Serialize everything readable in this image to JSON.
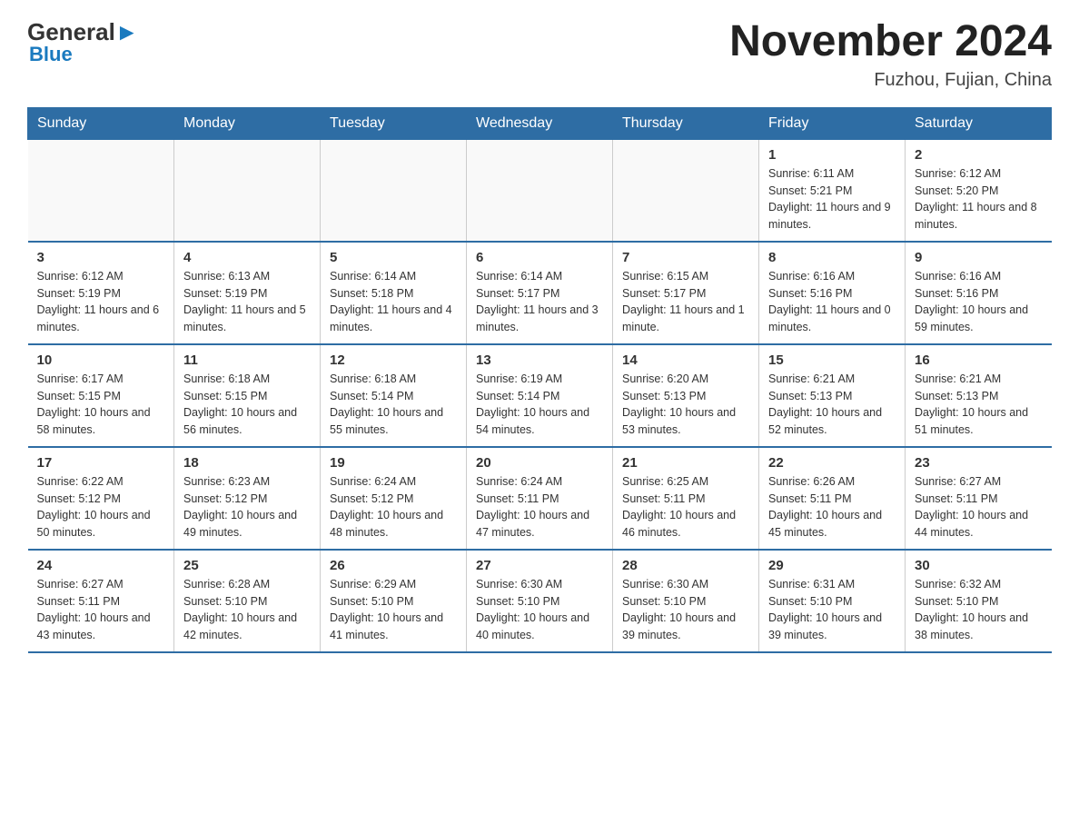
{
  "header": {
    "logo_general": "General",
    "logo_blue": "Blue",
    "month_title": "November 2024",
    "location": "Fuzhou, Fujian, China"
  },
  "days_of_week": [
    "Sunday",
    "Monday",
    "Tuesday",
    "Wednesday",
    "Thursday",
    "Friday",
    "Saturday"
  ],
  "weeks": [
    [
      {
        "day": "",
        "info": ""
      },
      {
        "day": "",
        "info": ""
      },
      {
        "day": "",
        "info": ""
      },
      {
        "day": "",
        "info": ""
      },
      {
        "day": "",
        "info": ""
      },
      {
        "day": "1",
        "info": "Sunrise: 6:11 AM\nSunset: 5:21 PM\nDaylight: 11 hours and 9 minutes."
      },
      {
        "day": "2",
        "info": "Sunrise: 6:12 AM\nSunset: 5:20 PM\nDaylight: 11 hours and 8 minutes."
      }
    ],
    [
      {
        "day": "3",
        "info": "Sunrise: 6:12 AM\nSunset: 5:19 PM\nDaylight: 11 hours and 6 minutes."
      },
      {
        "day": "4",
        "info": "Sunrise: 6:13 AM\nSunset: 5:19 PM\nDaylight: 11 hours and 5 minutes."
      },
      {
        "day": "5",
        "info": "Sunrise: 6:14 AM\nSunset: 5:18 PM\nDaylight: 11 hours and 4 minutes."
      },
      {
        "day": "6",
        "info": "Sunrise: 6:14 AM\nSunset: 5:17 PM\nDaylight: 11 hours and 3 minutes."
      },
      {
        "day": "7",
        "info": "Sunrise: 6:15 AM\nSunset: 5:17 PM\nDaylight: 11 hours and 1 minute."
      },
      {
        "day": "8",
        "info": "Sunrise: 6:16 AM\nSunset: 5:16 PM\nDaylight: 11 hours and 0 minutes."
      },
      {
        "day": "9",
        "info": "Sunrise: 6:16 AM\nSunset: 5:16 PM\nDaylight: 10 hours and 59 minutes."
      }
    ],
    [
      {
        "day": "10",
        "info": "Sunrise: 6:17 AM\nSunset: 5:15 PM\nDaylight: 10 hours and 58 minutes."
      },
      {
        "day": "11",
        "info": "Sunrise: 6:18 AM\nSunset: 5:15 PM\nDaylight: 10 hours and 56 minutes."
      },
      {
        "day": "12",
        "info": "Sunrise: 6:18 AM\nSunset: 5:14 PM\nDaylight: 10 hours and 55 minutes."
      },
      {
        "day": "13",
        "info": "Sunrise: 6:19 AM\nSunset: 5:14 PM\nDaylight: 10 hours and 54 minutes."
      },
      {
        "day": "14",
        "info": "Sunrise: 6:20 AM\nSunset: 5:13 PM\nDaylight: 10 hours and 53 minutes."
      },
      {
        "day": "15",
        "info": "Sunrise: 6:21 AM\nSunset: 5:13 PM\nDaylight: 10 hours and 52 minutes."
      },
      {
        "day": "16",
        "info": "Sunrise: 6:21 AM\nSunset: 5:13 PM\nDaylight: 10 hours and 51 minutes."
      }
    ],
    [
      {
        "day": "17",
        "info": "Sunrise: 6:22 AM\nSunset: 5:12 PM\nDaylight: 10 hours and 50 minutes."
      },
      {
        "day": "18",
        "info": "Sunrise: 6:23 AM\nSunset: 5:12 PM\nDaylight: 10 hours and 49 minutes."
      },
      {
        "day": "19",
        "info": "Sunrise: 6:24 AM\nSunset: 5:12 PM\nDaylight: 10 hours and 48 minutes."
      },
      {
        "day": "20",
        "info": "Sunrise: 6:24 AM\nSunset: 5:11 PM\nDaylight: 10 hours and 47 minutes."
      },
      {
        "day": "21",
        "info": "Sunrise: 6:25 AM\nSunset: 5:11 PM\nDaylight: 10 hours and 46 minutes."
      },
      {
        "day": "22",
        "info": "Sunrise: 6:26 AM\nSunset: 5:11 PM\nDaylight: 10 hours and 45 minutes."
      },
      {
        "day": "23",
        "info": "Sunrise: 6:27 AM\nSunset: 5:11 PM\nDaylight: 10 hours and 44 minutes."
      }
    ],
    [
      {
        "day": "24",
        "info": "Sunrise: 6:27 AM\nSunset: 5:11 PM\nDaylight: 10 hours and 43 minutes."
      },
      {
        "day": "25",
        "info": "Sunrise: 6:28 AM\nSunset: 5:10 PM\nDaylight: 10 hours and 42 minutes."
      },
      {
        "day": "26",
        "info": "Sunrise: 6:29 AM\nSunset: 5:10 PM\nDaylight: 10 hours and 41 minutes."
      },
      {
        "day": "27",
        "info": "Sunrise: 6:30 AM\nSunset: 5:10 PM\nDaylight: 10 hours and 40 minutes."
      },
      {
        "day": "28",
        "info": "Sunrise: 6:30 AM\nSunset: 5:10 PM\nDaylight: 10 hours and 39 minutes."
      },
      {
        "day": "29",
        "info": "Sunrise: 6:31 AM\nSunset: 5:10 PM\nDaylight: 10 hours and 39 minutes."
      },
      {
        "day": "30",
        "info": "Sunrise: 6:32 AM\nSunset: 5:10 PM\nDaylight: 10 hours and 38 minutes."
      }
    ]
  ]
}
